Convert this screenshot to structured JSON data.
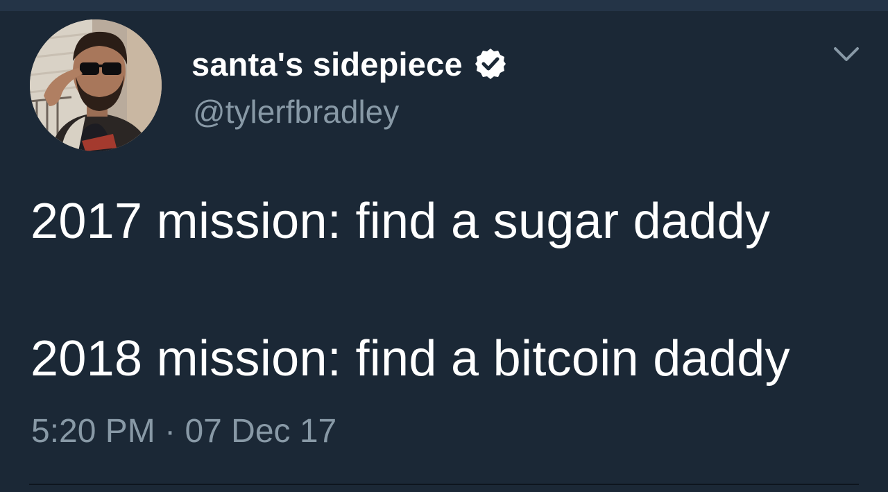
{
  "tweet": {
    "display_name": "santa's sidepiece",
    "handle": "@tylerfbradley",
    "verified": true,
    "body_lines": [
      "2017 mission: find a sugar daddy",
      "2018 mission: find a bitcoin daddy"
    ],
    "time": "5:20 PM",
    "separator": "·",
    "date": "07 Dec 17"
  },
  "icons": {
    "verified": "verified-badge-icon",
    "menu": "chevron-down-icon"
  },
  "colors": {
    "background": "#1b2836",
    "topbar": "#243447",
    "primary_text": "#ffffff",
    "secondary_text": "#8899a6"
  }
}
